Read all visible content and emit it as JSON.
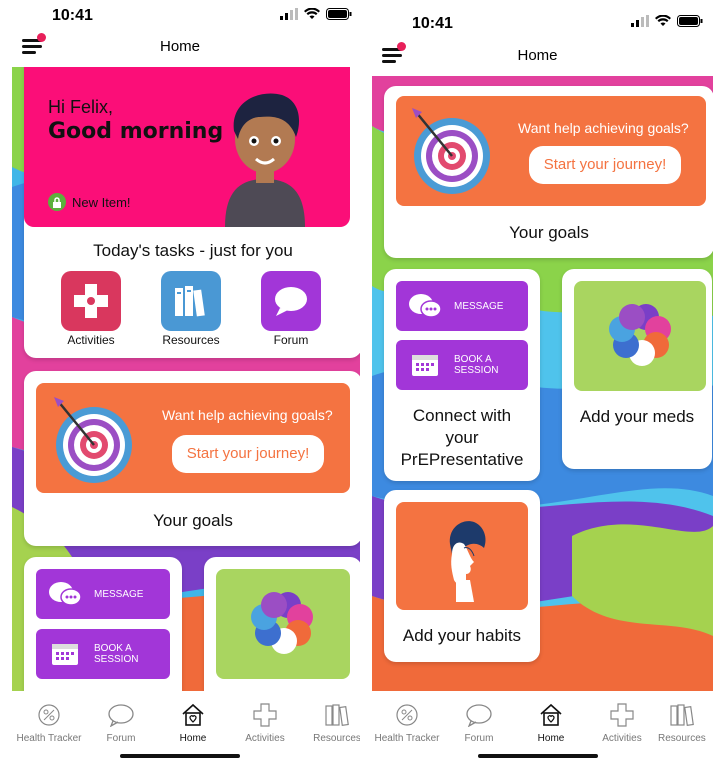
{
  "status": {
    "time": "10:41"
  },
  "nav": {
    "title": "Home"
  },
  "greeting": {
    "line1": "Hi Felix,",
    "line2": "Good morning",
    "new_item": "New Item!"
  },
  "tasks": {
    "title": "Today's tasks - just for you",
    "items": [
      {
        "label": "Activities",
        "icon": "puzzle-icon",
        "color": "#d9375e"
      },
      {
        "label": "Resources",
        "icon": "books-icon",
        "color": "#4a98d4"
      },
      {
        "label": "Forum",
        "icon": "speech-bubble-icon",
        "color": "#a236d8"
      }
    ]
  },
  "goals": {
    "question": "Want help achieving goals?",
    "button": "Start your journey!",
    "title": "Your goals"
  },
  "connect": {
    "message": "MESSAGE",
    "book": "BOOK A SESSION",
    "book_line1": "BOOK A",
    "book_line2": "SESSION",
    "title": "Connect with your PrEPresentative"
  },
  "meds": {
    "title": "Add your meds"
  },
  "habits": {
    "title": "Add your habits"
  },
  "tabbar": {
    "items": [
      {
        "label": "Health Tracker",
        "icon": "health-tracker-icon"
      },
      {
        "label": "Forum",
        "icon": "forum-icon"
      },
      {
        "label": "Home",
        "icon": "home-icon",
        "active": true
      },
      {
        "label": "Activities",
        "icon": "activities-icon"
      },
      {
        "label": "Resources",
        "icon": "resources-icon"
      }
    ]
  },
  "colors": {
    "accent_pink": "#fb0e78",
    "goal_orange": "#f47341",
    "purple": "#a236d8",
    "green": "#a9d560",
    "badge_red": "#e8205a"
  }
}
